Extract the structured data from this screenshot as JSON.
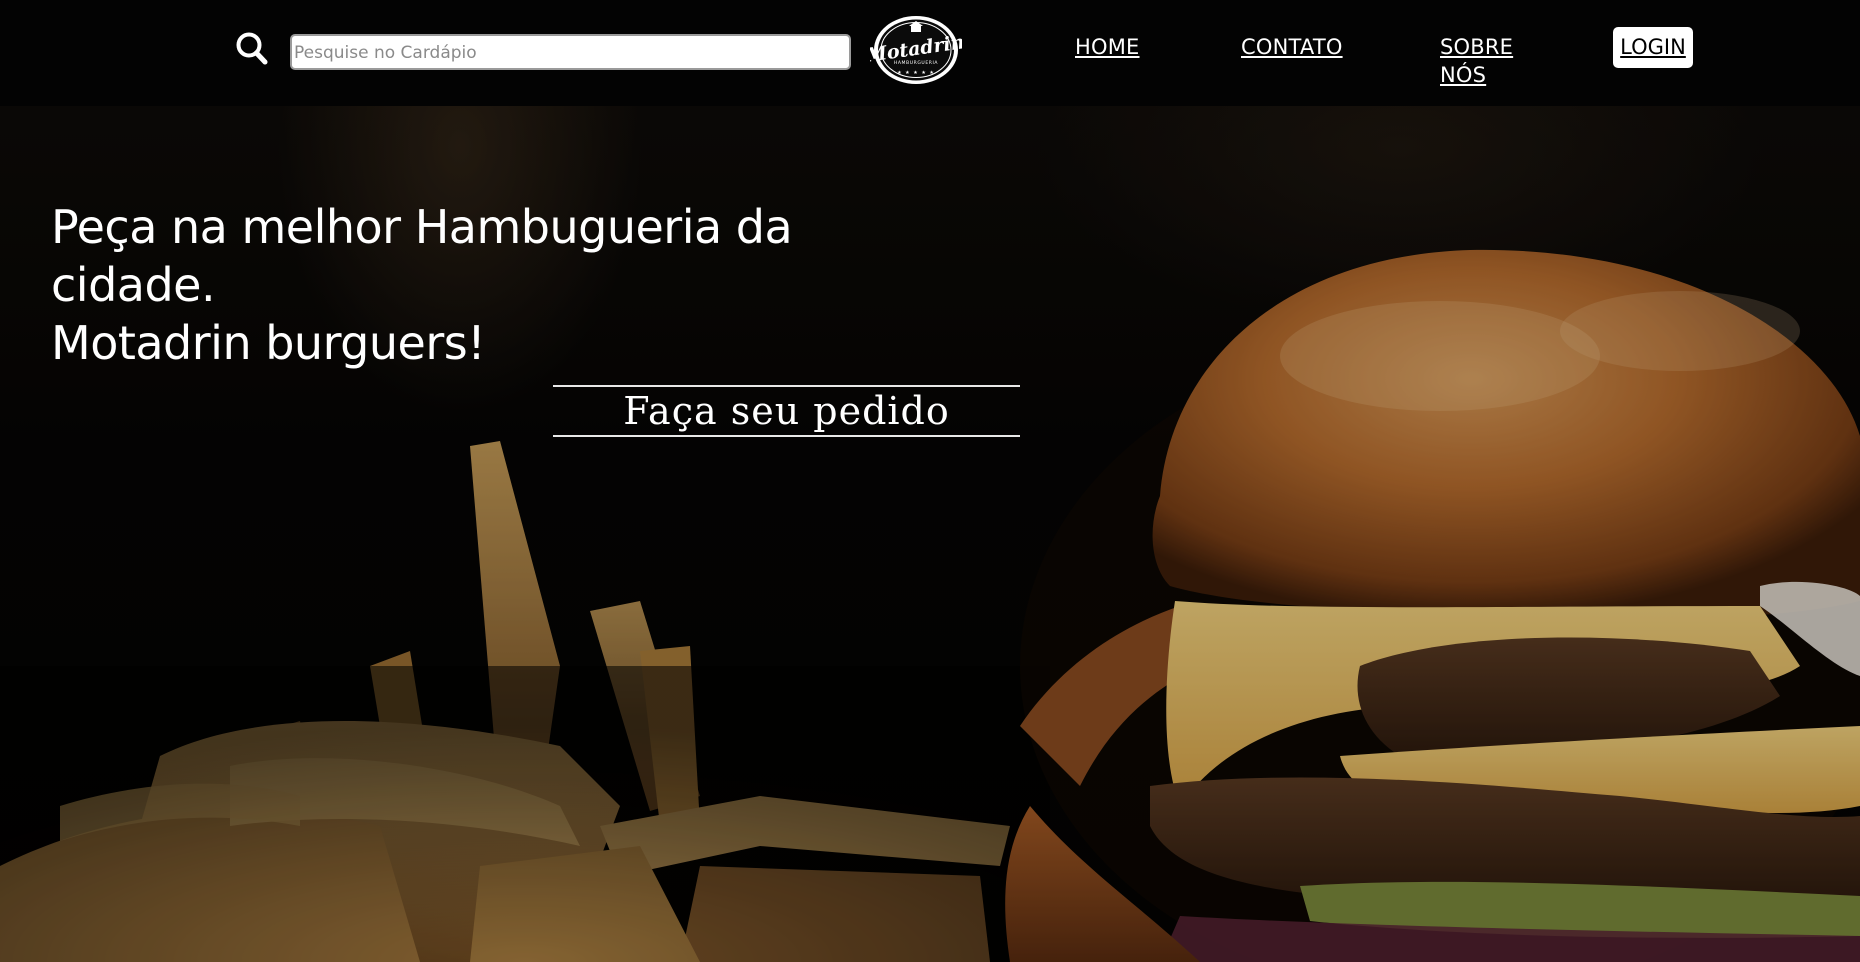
{
  "header": {
    "search_icon": "search-icon",
    "search_placeholder": "Pesquise no Cardápio",
    "logo_text": "Motadrin",
    "logo_subtext": "HAMBURGUERIA",
    "nav": {
      "home": "HOME",
      "contato": "CONTATO",
      "sobre_line1": "SOBRE",
      "sobre_line2": "NÓS",
      "login": "LOGIN"
    }
  },
  "hero": {
    "title_line1": "Peça na melhor Hambugueria da cidade.",
    "title_line2": "Motadrin burguers!",
    "order_button": "Faça seu pedido",
    "background_image": "burger-and-fries-photo"
  },
  "colors": {
    "header_bg": "#030303",
    "text": "#ffffff",
    "bun": "#b86d2e",
    "cheese": "#e9bf63",
    "fries": "#c99a52"
  }
}
